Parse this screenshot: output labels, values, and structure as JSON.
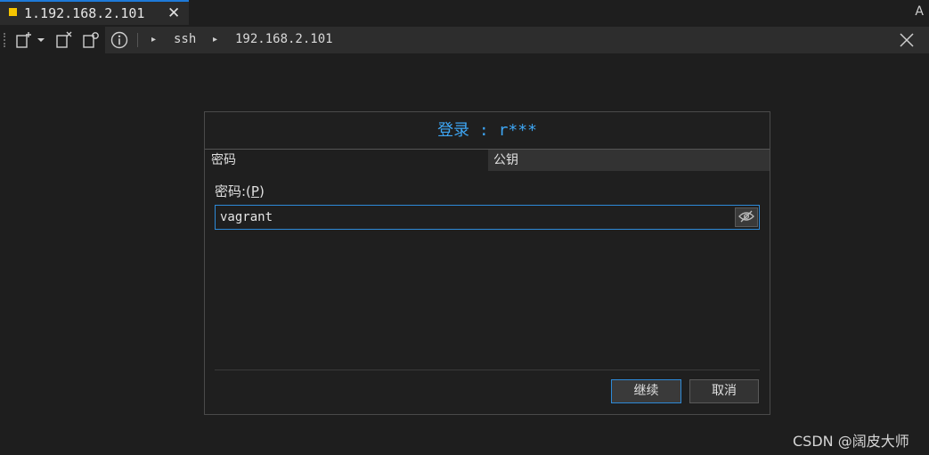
{
  "tab": {
    "title": "1.192.168.2.101",
    "close_glyph": "✕",
    "marker_color": "#f5c400"
  },
  "tabbar_right": "A",
  "toolbar": {
    "icons": [
      "new-session-icon",
      "dropdown-icon",
      "close-session-icon",
      "refresh-session-icon",
      "info-icon"
    ],
    "breadcrumb": [
      "ssh",
      "192.168.2.101"
    ],
    "arrow_glyph": "▸"
  },
  "dialog": {
    "title": "登录 : r***",
    "tabs": [
      {
        "label": "密码",
        "active": true
      },
      {
        "label": "公钥",
        "active": false
      }
    ],
    "password_label_prefix": "密码:(",
    "password_label_key": "P",
    "password_label_suffix": ")",
    "password_value": "vagrant",
    "continue_label": "继续",
    "cancel_label": "取消",
    "accent_color": "#3ea6f4"
  },
  "watermark": "CSDN @阔皮大师"
}
